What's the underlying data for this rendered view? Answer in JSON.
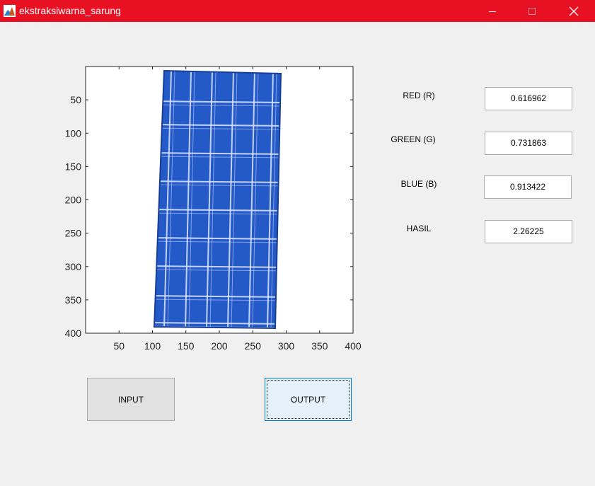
{
  "window": {
    "title": "ekstraksiwarna_sarung",
    "accent_color": "#e81123",
    "icons": {
      "app": "matlab-icon",
      "minimize": "minimize-icon",
      "maximize": "maximize-icon",
      "close": "close-icon"
    }
  },
  "axes": {
    "x_ticks": [
      "50",
      "100",
      "150",
      "200",
      "250",
      "300",
      "350",
      "400"
    ],
    "y_ticks": [
      "50",
      "100",
      "150",
      "200",
      "250",
      "300",
      "350",
      "400"
    ],
    "xlim": [
      0,
      400
    ],
    "ylim": [
      0,
      400
    ],
    "image": {
      "subject": "blue plaid sarung cloth",
      "fabric_color": "#2459c8",
      "line_color": "#dfe8ff"
    }
  },
  "fields": [
    {
      "label": "RED (R)",
      "value": "0.616962"
    },
    {
      "label": "GREEN (G)",
      "value": "0.731863"
    },
    {
      "label": "BLUE (B)",
      "value": "0.913422"
    },
    {
      "label": "HASIL",
      "value": "2.26225"
    }
  ],
  "buttons": {
    "input_label": "INPUT",
    "output_label": "OUTPUT"
  }
}
